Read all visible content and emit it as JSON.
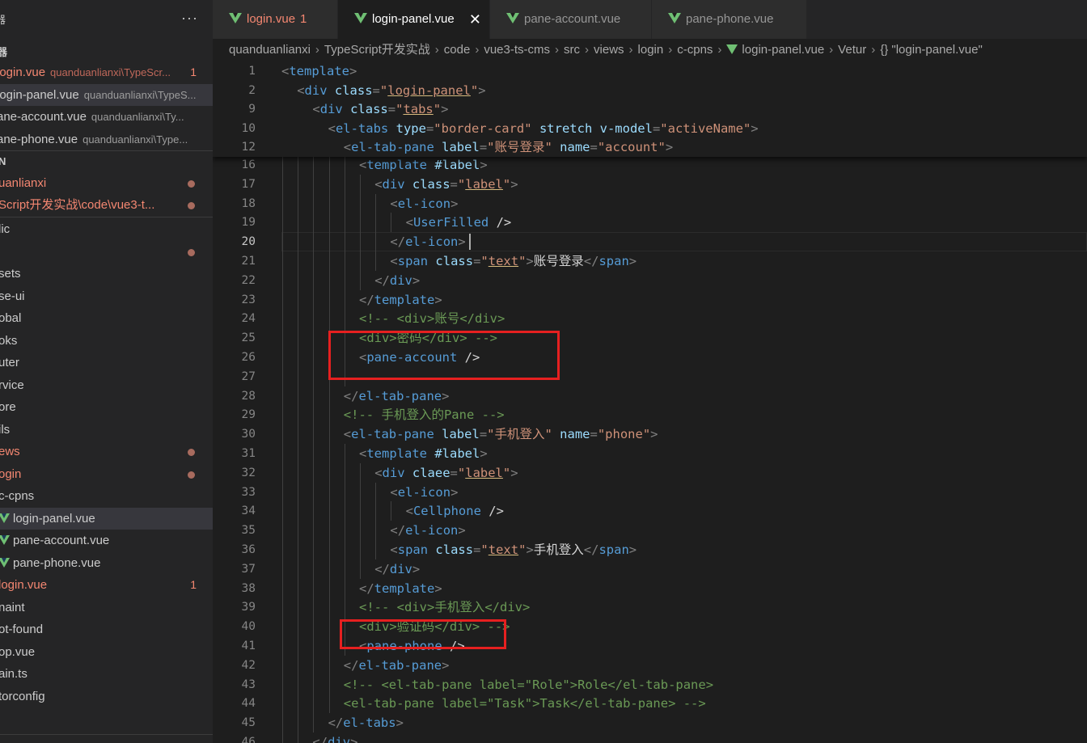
{
  "sidebar": {
    "more_actions": "···",
    "open_editors_title": "器",
    "open_editors": [
      {
        "name": "login.vue",
        "desc": "quanduanlianxi\\TypeScr...",
        "badge": "1",
        "red": true
      },
      {
        "name": "login-panel.vue",
        "desc": "quanduanlianxi\\TypeS...",
        "selected": true
      },
      {
        "name": "ane-account.vue",
        "desc": "quanduanlianxi\\Ty..."
      },
      {
        "name": "ane-phone.vue",
        "desc": "quanduanlianxi\\Type..."
      }
    ],
    "workspace_title": "N",
    "workspace_items": [
      {
        "name": "uanlianxi",
        "red": true
      },
      {
        "name": "Script开发实战\\code\\vue3-t...",
        "red": true
      }
    ],
    "tree": [
      {
        "label": "lic"
      },
      {
        "label": ""
      },
      {
        "label": "sets"
      },
      {
        "label": "se-ui"
      },
      {
        "label": "obal"
      },
      {
        "label": "oks"
      },
      {
        "label": "uter"
      },
      {
        "label": "rvice"
      },
      {
        "label": "ore"
      },
      {
        "label": "ils"
      },
      {
        "label": "ews",
        "red": true
      },
      {
        "label": "ogin",
        "red": true
      },
      {
        "label": "c-cpns"
      },
      {
        "label": "login-panel.vue",
        "vue": true
      },
      {
        "label": "pane-account.vue",
        "vue": true
      },
      {
        "label": "pane-phone.vue",
        "vue": true
      },
      {
        "label": "login.vue",
        "red": true,
        "badge": "1"
      },
      {
        "label": "naint"
      },
      {
        "label": "ot-found"
      },
      {
        "label": "op.vue"
      },
      {
        "label": "ain.ts"
      },
      {
        "label": "torconfig"
      },
      {
        "label": ""
      }
    ]
  },
  "tabs": [
    {
      "label": "login.vue",
      "count": "1",
      "red": true
    },
    {
      "label": "login-panel.vue",
      "active": true,
      "close": "✕"
    },
    {
      "label": "pane-account.vue"
    },
    {
      "label": "pane-phone.vue"
    }
  ],
  "breadcrumb": [
    "quanduanlianxi",
    "TypeScript开发实战",
    "code",
    "vue3-ts-cms",
    "src",
    "views",
    "login",
    "c-cpns",
    "login-panel.vue",
    "Vetur",
    "{} \"login-panel.vue\""
  ],
  "sticky_lines": [
    {
      "num": "1",
      "indent": 0,
      "html_key": "l1"
    },
    {
      "num": "2",
      "indent": 1,
      "html_key": "l2"
    },
    {
      "num": "9",
      "indent": 2,
      "html_key": "l9"
    },
    {
      "num": "10",
      "indent": 3,
      "html_key": "l10"
    },
    {
      "num": "12",
      "indent": 4,
      "html_key": "l12"
    }
  ],
  "code_lines": [
    {
      "num": "16",
      "text": "<template #label>"
    },
    {
      "num": "17",
      "text": "<div class=\"label\">"
    },
    {
      "num": "18",
      "text": "<el-icon>"
    },
    {
      "num": "19",
      "text": "<UserFilled />"
    },
    {
      "num": "20",
      "text": "</el-icon>"
    },
    {
      "num": "21",
      "text": "<span class=\"text\">账号登录</span>"
    },
    {
      "num": "22",
      "text": "</div>"
    },
    {
      "num": "23",
      "text": "</template>"
    },
    {
      "num": "24",
      "text": "<!-- <div>账号</div>"
    },
    {
      "num": "25",
      "text": "<div>密码</div> -->"
    },
    {
      "num": "26",
      "text": "<pane-account />"
    },
    {
      "num": "27",
      "text": ""
    },
    {
      "num": "28",
      "text": "</el-tab-pane>"
    },
    {
      "num": "29",
      "text": "<!-- 手机登入的Pane -->"
    },
    {
      "num": "30",
      "text": "<el-tab-pane label=\"手机登入\" name=\"phone\">"
    },
    {
      "num": "31",
      "text": "<template #label>"
    },
    {
      "num": "32",
      "text": "<div claee=\"label\">"
    },
    {
      "num": "33",
      "text": "<el-icon>"
    },
    {
      "num": "34",
      "text": "<Cellphone />"
    },
    {
      "num": "35",
      "text": "</el-icon>"
    },
    {
      "num": "36",
      "text": "<span class=\"text\">手机登入</span>"
    },
    {
      "num": "37",
      "text": "</div>"
    },
    {
      "num": "38",
      "text": "</template>"
    },
    {
      "num": "39",
      "text": "<!-- <div>手机登入</div>"
    },
    {
      "num": "40",
      "text": "<div>验证码</div> -->"
    },
    {
      "num": "41",
      "text": "<pane-phone />"
    },
    {
      "num": "42",
      "text": "</el-tab-pane>"
    },
    {
      "num": "43",
      "text": "<!-- <el-tab-pane label=\"Role\">Role</el-tab-pane>"
    },
    {
      "num": "44",
      "text": "<el-tab-pane label=\"Task\">Task</el-tab-pane> -->"
    },
    {
      "num": "45",
      "text": "</el-tabs>"
    },
    {
      "num": "46",
      "text": "</div>"
    }
  ],
  "sticky_text": {
    "l1": "<template>",
    "l2": "<div class=\"login-panel\">",
    "l9": "<div class=\"tabs\">",
    "l10": "<el-tabs type=\"border-card\" stretch v-model=\"activeName\">",
    "l12": "<el-tab-pane label=\"账号登录\" name=\"account\">"
  },
  "current_line": "20",
  "colors": {
    "accent_vue": "#6fbf73",
    "modified": "#f48771",
    "highlight_box": "#e62020"
  }
}
